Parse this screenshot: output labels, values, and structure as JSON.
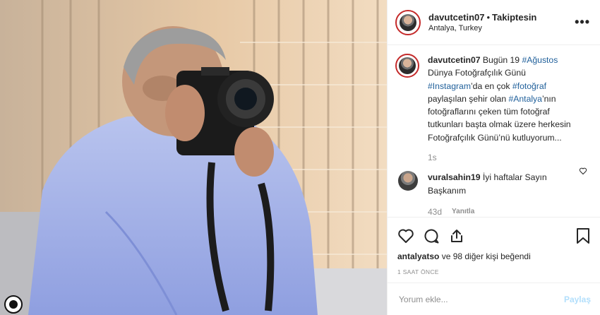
{
  "header": {
    "username": "davutcetin07",
    "separator": "•",
    "follow_status": "Takiptesin",
    "location": "Antalya, Turkey",
    "more_icon": "more-horizontal-icon"
  },
  "caption": {
    "username": "davutcetin07",
    "t1": "Bugün 19 ",
    "tag1": "#Ağustos",
    "t2": " Dünya Fotoğrafçılık Günü ",
    "tag2": "#Instagram",
    "t3": "’da en çok ",
    "tag3": "#fotoğraf",
    "t4": " paylaşılan şehir olan ",
    "tag4": "#Antalya",
    "t5": "’nın fotoğraflarını çeken tüm fotoğraf tutkunları başta olmak üzere herkesin Fotoğrafçılık Günü’nü kutluyorum...",
    "age": "1s"
  },
  "reply": {
    "username": "vuralsahin19",
    "text": "İyi haftalar Sayın Başkanım",
    "age": "43d",
    "reply_label": "Yanıtla"
  },
  "actions": {
    "icons": [
      "heart-icon",
      "comment-icon",
      "share-icon",
      "bookmark-icon"
    ],
    "likes_user": "antalyatso",
    "likes_rest": " ve 98 diğer kişi beğendi",
    "time": "1 SAAT ÖNCE"
  },
  "composer": {
    "placeholder": "Yorum ekle...",
    "post_label": "Paylaş"
  },
  "colors": {
    "hashtag": "#1f5f9a",
    "muted": "#8e8e8e",
    "post_disabled": "#b2dffc",
    "avatar_ring": "#c42a2a"
  }
}
